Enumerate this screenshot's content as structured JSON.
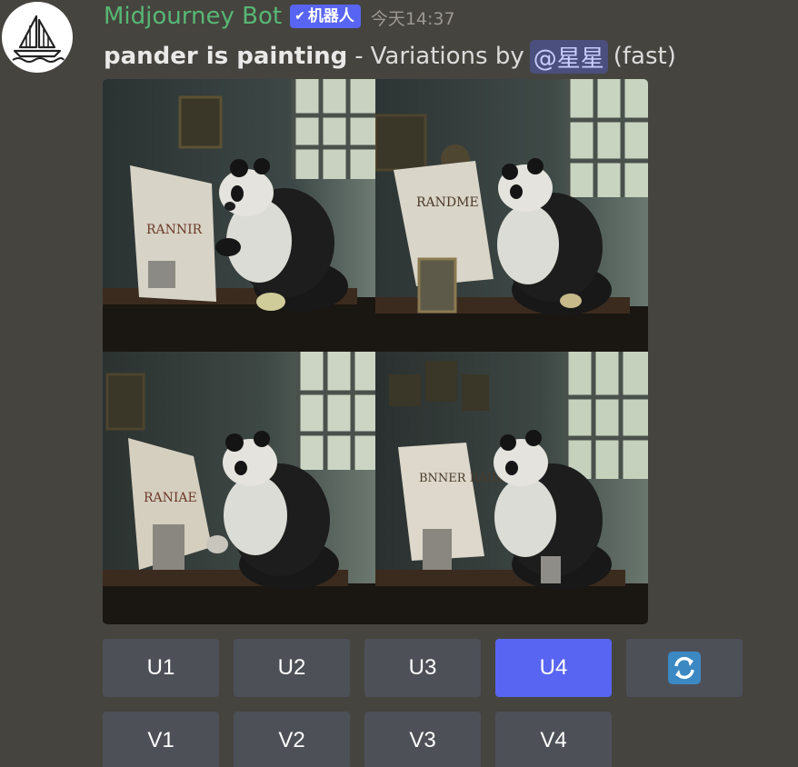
{
  "author": {
    "name": "Midjourney Bot",
    "bot_tag": "机器人",
    "timestamp": "今天14:37",
    "avatar_icon": "sailboat-icon"
  },
  "message": {
    "prompt": "pander is painting",
    "separator": "-",
    "variations_text": "Variations by",
    "mention": "@星星",
    "mode": "(fast)"
  },
  "image": {
    "panels": [
      {
        "canvas_text": "RANNIR"
      },
      {
        "canvas_text": "RANDME"
      },
      {
        "canvas_text": "RANIAE"
      },
      {
        "canvas_text": "BNNER RAIIIP"
      }
    ]
  },
  "buttons": {
    "upscale": [
      "U1",
      "U2",
      "U3",
      "U4"
    ],
    "reroll_icon": "refresh-icon",
    "variation": [
      "V1",
      "V2",
      "V3",
      "V4"
    ]
  },
  "colors": {
    "background": "#46443f",
    "username": "#57b774",
    "bot_tag": "#5865f2",
    "button": "#4e5058",
    "button_active": "#5865f2",
    "mention_bg": "#4b4f7d"
  }
}
